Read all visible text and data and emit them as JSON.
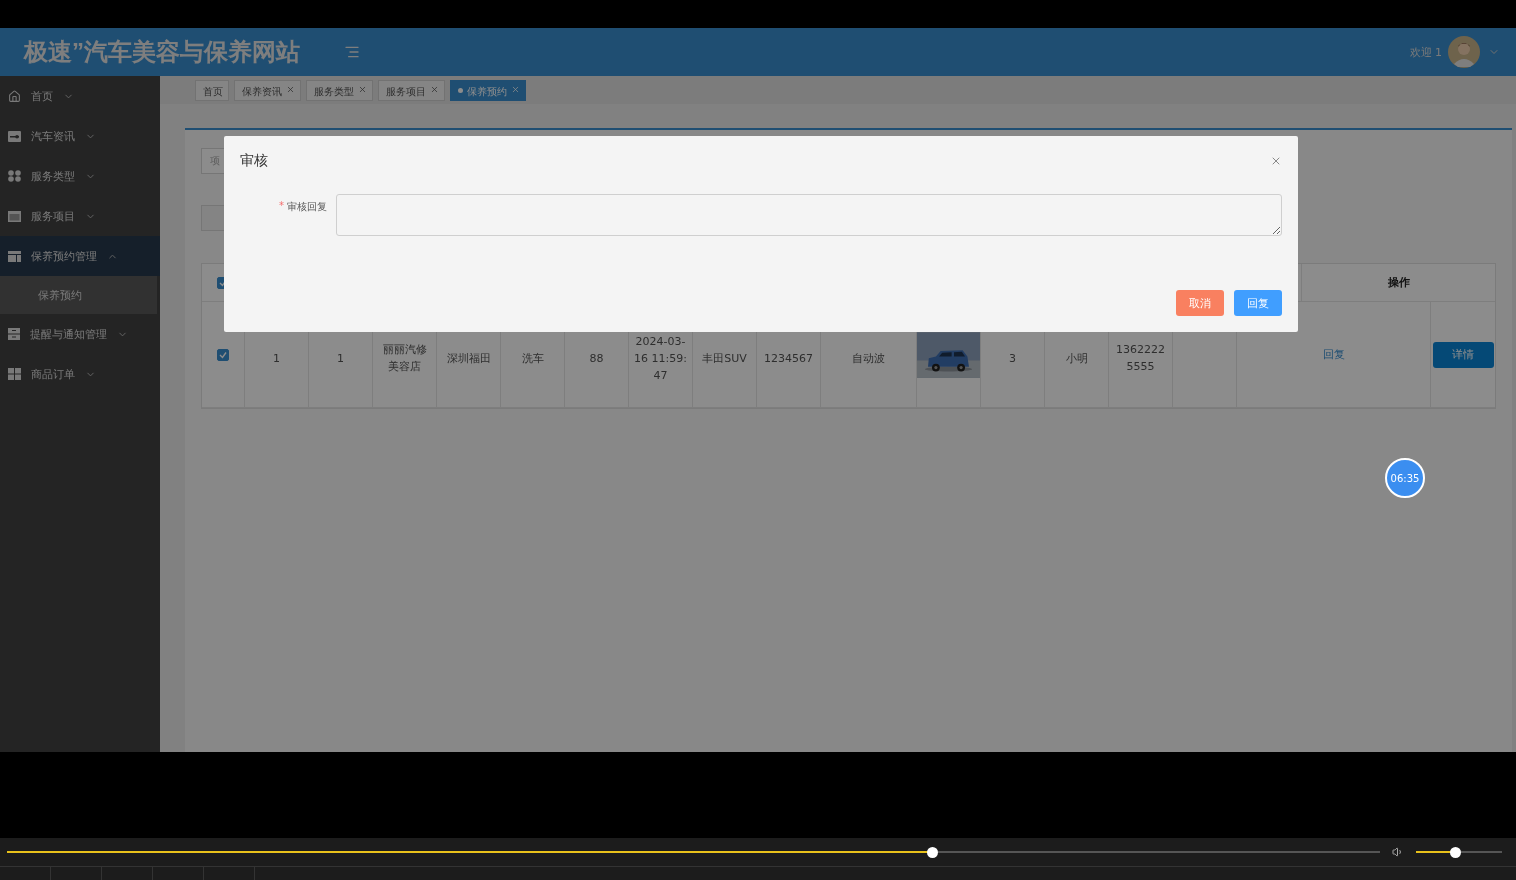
{
  "header": {
    "title": "极速”汽车美容与保养网站",
    "greeting": "欢迎 1"
  },
  "sidebar": {
    "items": [
      {
        "label": "首页",
        "expanded": false
      },
      {
        "label": "汽车资讯",
        "expanded": false
      },
      {
        "label": "服务类型",
        "expanded": false
      },
      {
        "label": "服务项目",
        "expanded": false
      },
      {
        "label": "保养预约管理",
        "expanded": true,
        "children": [
          {
            "label": "保养预约",
            "selected": true
          }
        ]
      },
      {
        "label": "提醒与通知管理",
        "expanded": false
      },
      {
        "label": "商品订单",
        "expanded": false
      }
    ]
  },
  "tabs": [
    {
      "label": "首页",
      "closable": false,
      "selected": false
    },
    {
      "label": "保养资讯",
      "closable": true,
      "selected": false
    },
    {
      "label": "服务类型",
      "closable": true,
      "selected": false
    },
    {
      "label": "服务项目",
      "closable": true,
      "selected": false
    },
    {
      "label": "保养预约",
      "closable": true,
      "selected": true
    }
  ],
  "search": {
    "placeholder": "项"
  },
  "table": {
    "header": {
      "checked": true,
      "action_label": "操作"
    },
    "rows": [
      {
        "checked": true,
        "cells": [
          {
            "kind": "text",
            "text": "1"
          },
          {
            "kind": "text",
            "text": "1"
          },
          {
            "kind": "text",
            "text": "丽丽汽修美容店"
          },
          {
            "kind": "text",
            "text": "深圳福田"
          },
          {
            "kind": "text",
            "text": "洗车"
          },
          {
            "kind": "text",
            "text": "88"
          },
          {
            "kind": "text",
            "text": "2024-03-16 11:59:47"
          },
          {
            "kind": "text",
            "text": "丰田SUV"
          },
          {
            "kind": "text",
            "text": "1234567"
          },
          {
            "kind": "text",
            "text": "自动波"
          },
          {
            "kind": "picture"
          },
          {
            "kind": "text",
            "text": "3"
          },
          {
            "kind": "text",
            "text": "小明"
          },
          {
            "kind": "text",
            "text": "13622225555"
          },
          {
            "kind": "empty"
          },
          {
            "kind": "link",
            "text": "回复"
          },
          {
            "kind": "button",
            "text": "详情"
          }
        ]
      }
    ]
  },
  "modal": {
    "title": "审核",
    "field_label": "审核回复",
    "required_mark": "*",
    "cancel": "取消",
    "confirm": "回复"
  },
  "timer": "06:35",
  "player": {
    "progress": {
      "level": 0.674
    },
    "volume": {
      "level": 0.45
    }
  }
}
